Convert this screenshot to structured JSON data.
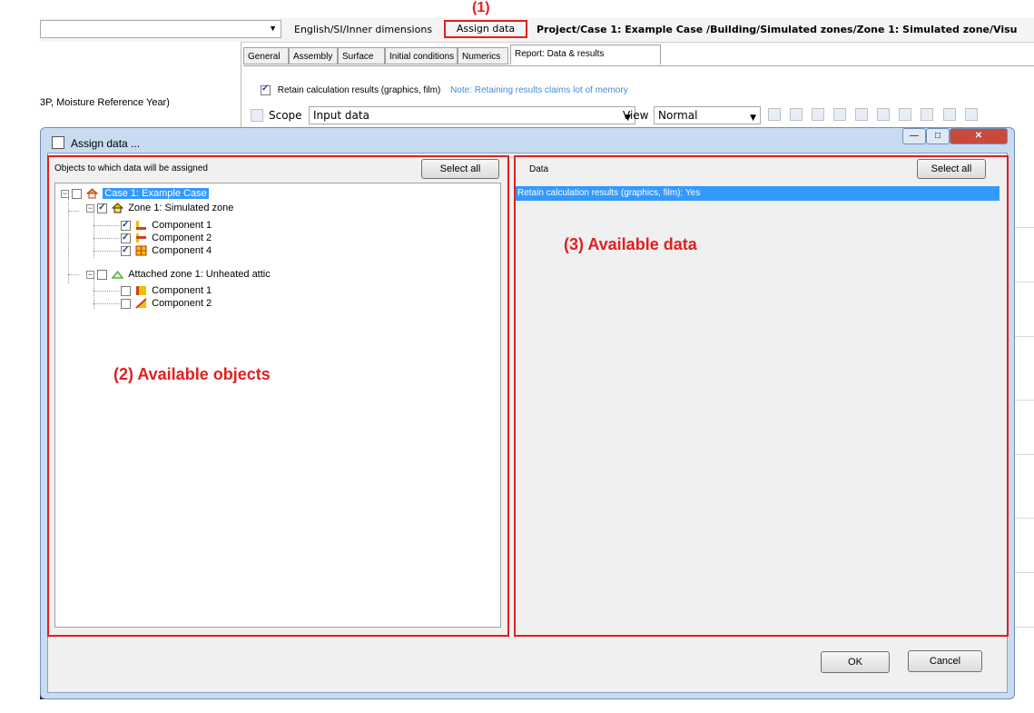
{
  "annotations": {
    "a1": "(1)",
    "a2": "(2) Available objects",
    "a3": "(3) Available data"
  },
  "toolbar": {
    "units": "English/SI/Inner dimensions",
    "assign_data": "Assign data",
    "path": "Project/Case 1: Example Case /Building/Simulated zones/Zone 1: Simulated zone/Visu"
  },
  "background": {
    "climate_text": "3P, Moisture Reference Year)",
    "tabs": [
      "General",
      "Assembly",
      "Surface",
      "Initial conditions",
      "Numerics",
      "Report: Data & results"
    ],
    "retain_label": "Retain calculation results (graphics, film)",
    "retain_note": "Note: Retaining results claims lot of memory",
    "scope_label": "Scope",
    "scope_value": "Input data",
    "view_label": "View",
    "view_value": "Normal"
  },
  "dialog": {
    "title": "Assign data ...",
    "objects_header": "Objects to which data will be assigned",
    "select_all": "Select all",
    "data_header": "Data",
    "data_items": [
      "Retain calculation results (graphics, film): Yes"
    ],
    "ok": "OK",
    "cancel": "Cancel"
  },
  "tree": [
    {
      "label": "Case 1: Example Case",
      "checked": false,
      "selected": true,
      "icon": "house-icon"
    },
    {
      "label": "Zone 1: Simulated zone",
      "checked": true,
      "icon": "house-zone-icon"
    },
    {
      "label": "Component 1",
      "checked": true,
      "icon": "component-icon"
    },
    {
      "label": "Component 2",
      "checked": true,
      "icon": "component-icon"
    },
    {
      "label": "Component 4",
      "checked": true,
      "icon": "window-icon"
    },
    {
      "label": "Attached zone 1: Unheated attic",
      "checked": false,
      "icon": "roof-icon"
    },
    {
      "label": "Component 1",
      "checked": false,
      "icon": "component-icon"
    },
    {
      "label": "Component 2",
      "checked": false,
      "icon": "component-icon"
    }
  ],
  "colors": {
    "annotation": "#e02020",
    "selection": "#3399ff",
    "note": "#4a88d6"
  }
}
